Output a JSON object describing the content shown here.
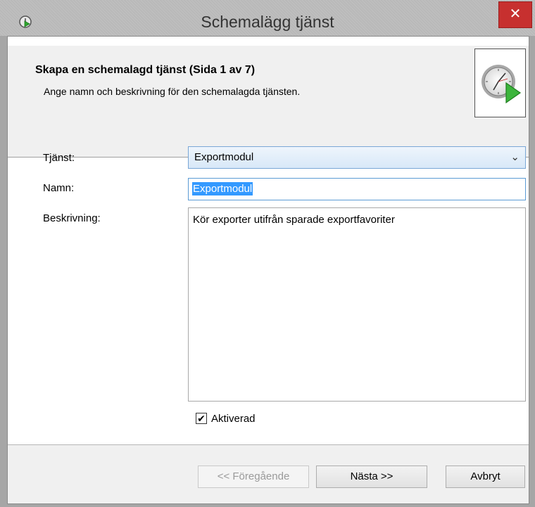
{
  "window": {
    "title": "Schemalägg tjänst",
    "close_symbol": "✕",
    "icon": "schedule-app-icon"
  },
  "header": {
    "title": "Skapa en schemalagd tjänst (Sida 1 av 7)",
    "subtitle": "Ange namn och beskrivning för den schemalagda tjänsten.",
    "icon": "clock-play-icon"
  },
  "form": {
    "service_label": "Tjänst:",
    "service_value": "Exportmodul",
    "name_label": "Namn:",
    "name_value": "Exportmodul",
    "description_label": "Beskrivning:",
    "description_value": "Kör exporter utifrån sparade exportfavoriter",
    "enabled_label": "Aktiverad",
    "enabled_checked": true,
    "check_symbol": "✔"
  },
  "footer": {
    "prev_label": "<< Föregående",
    "next_label": "Nästa >>",
    "cancel_label": "Avbryt"
  },
  "colors": {
    "close": "#c7302f",
    "selection": "#3399ff",
    "focus_border": "#5b9bd5"
  }
}
